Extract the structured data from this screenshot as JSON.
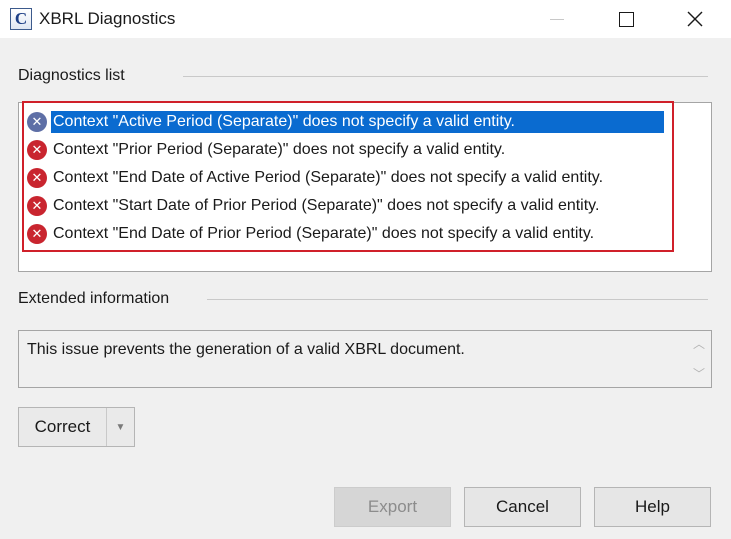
{
  "window": {
    "title": "XBRL Diagnostics",
    "app_icon_letter": "C"
  },
  "diagnostics": {
    "label": "Diagnostics list",
    "items": [
      {
        "text": "Context \"Active Period (Separate)\" does not specify a valid entity.",
        "severity": "error",
        "selected": true
      },
      {
        "text": "Context \"Prior Period (Separate)\" does not specify a valid entity.",
        "severity": "error",
        "selected": false
      },
      {
        "text": "Context \"End Date of Active Period (Separate)\" does not specify a valid entity.",
        "severity": "error",
        "selected": false
      },
      {
        "text": "Context \"Start Date of Prior Period (Separate)\" does not specify a valid entity.",
        "severity": "error",
        "selected": false
      },
      {
        "text": "Context \"End Date of Prior Period (Separate)\" does not specify a valid entity.",
        "severity": "error",
        "selected": false
      }
    ],
    "icon": "error-x-icon",
    "highlight_color": "#d0202a",
    "selection_color": "#0a6bd0"
  },
  "extended": {
    "label": "Extended information",
    "text": "This issue prevents the generation of a valid XBRL document."
  },
  "actions": {
    "correct_label": "Correct",
    "export_label": "Export",
    "export_enabled": false,
    "cancel_label": "Cancel",
    "help_label": "Help"
  }
}
